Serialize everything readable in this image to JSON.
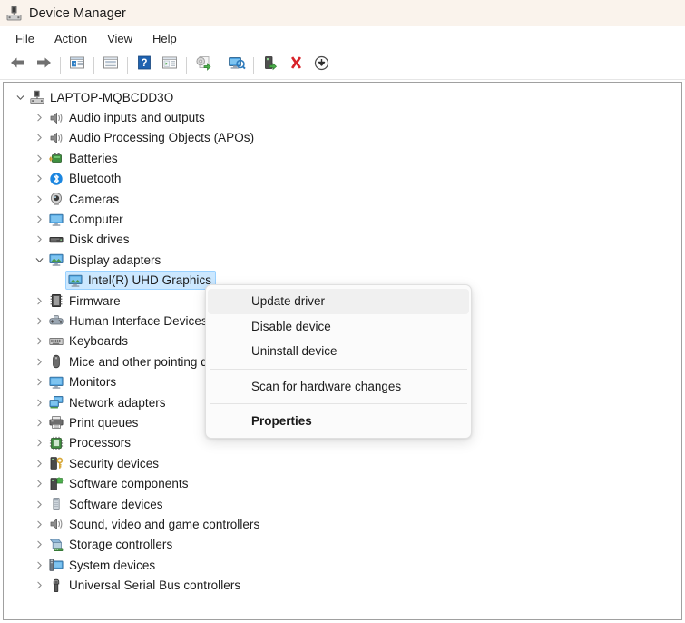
{
  "window": {
    "title": "Device Manager",
    "icon": "device-manager-icon"
  },
  "menubar": {
    "items": [
      {
        "label": "File",
        "name": "menu-file"
      },
      {
        "label": "Action",
        "name": "menu-action"
      },
      {
        "label": "View",
        "name": "menu-view"
      },
      {
        "label": "Help",
        "name": "menu-help"
      }
    ]
  },
  "toolbar": {
    "buttons": [
      {
        "icon": "back-arrow-icon",
        "name": "toolbar-back"
      },
      {
        "icon": "forward-arrow-icon",
        "name": "toolbar-forward"
      },
      {
        "icon": "separator",
        "name": "toolbar-separator-1"
      },
      {
        "icon": "show-hide-console-tree-icon",
        "name": "toolbar-console-tree"
      },
      {
        "icon": "separator",
        "name": "toolbar-separator-2"
      },
      {
        "icon": "properties-icon",
        "name": "toolbar-properties"
      },
      {
        "icon": "separator",
        "name": "toolbar-separator-3"
      },
      {
        "icon": "help-question-icon",
        "name": "toolbar-help"
      },
      {
        "icon": "show-hide-action-pane-icon",
        "name": "toolbar-action-pane"
      },
      {
        "icon": "separator",
        "name": "toolbar-separator-4"
      },
      {
        "icon": "update-driver-icon",
        "name": "toolbar-update-driver"
      },
      {
        "icon": "separator",
        "name": "toolbar-separator-5"
      },
      {
        "icon": "scan-hardware-changes-icon",
        "name": "toolbar-scan-hardware"
      },
      {
        "icon": "separator",
        "name": "toolbar-separator-6"
      },
      {
        "icon": "enable-device-icon",
        "name": "toolbar-enable-device"
      },
      {
        "icon": "uninstall-device-icon",
        "name": "toolbar-uninstall-device"
      },
      {
        "icon": "disable-device-icon",
        "name": "toolbar-disable-device"
      }
    ]
  },
  "tree": {
    "nodes": [
      {
        "label": "LAPTOP-MQBCDD3O",
        "depth": 0,
        "state": "expanded",
        "icon": "computer-root-icon",
        "selected": false
      },
      {
        "label": "Audio inputs and outputs",
        "depth": 1,
        "state": "collapsed",
        "icon": "speaker-icon",
        "selected": false
      },
      {
        "label": "Audio Processing Objects (APOs)",
        "depth": 1,
        "state": "collapsed",
        "icon": "speaker-icon",
        "selected": false
      },
      {
        "label": "Batteries",
        "depth": 1,
        "state": "collapsed",
        "icon": "battery-icon",
        "selected": false
      },
      {
        "label": "Bluetooth",
        "depth": 1,
        "state": "collapsed",
        "icon": "bluetooth-icon",
        "selected": false
      },
      {
        "label": "Cameras",
        "depth": 1,
        "state": "collapsed",
        "icon": "camera-icon",
        "selected": false
      },
      {
        "label": "Computer",
        "depth": 1,
        "state": "collapsed",
        "icon": "monitor-icon",
        "selected": false
      },
      {
        "label": "Disk drives",
        "depth": 1,
        "state": "collapsed",
        "icon": "disk-drive-icon",
        "selected": false
      },
      {
        "label": "Display adapters",
        "depth": 1,
        "state": "expanded",
        "icon": "display-adapter-icon",
        "selected": false
      },
      {
        "label": "Intel(R) UHD Graphics",
        "depth": 2,
        "state": "leaf",
        "icon": "display-adapter-icon",
        "selected": true
      },
      {
        "label": "Firmware",
        "depth": 1,
        "state": "collapsed",
        "icon": "firmware-icon",
        "selected": false
      },
      {
        "label": "Human Interface Devices",
        "depth": 1,
        "state": "collapsed",
        "icon": "hid-icon",
        "selected": false
      },
      {
        "label": "Keyboards",
        "depth": 1,
        "state": "collapsed",
        "icon": "keyboard-icon",
        "selected": false
      },
      {
        "label": "Mice and other pointing devices",
        "depth": 1,
        "state": "collapsed",
        "icon": "mouse-icon",
        "selected": false
      },
      {
        "label": "Monitors",
        "depth": 1,
        "state": "collapsed",
        "icon": "monitor-icon",
        "selected": false
      },
      {
        "label": "Network adapters",
        "depth": 1,
        "state": "collapsed",
        "icon": "network-adapter-icon",
        "selected": false
      },
      {
        "label": "Print queues",
        "depth": 1,
        "state": "collapsed",
        "icon": "printer-icon",
        "selected": false
      },
      {
        "label": "Processors",
        "depth": 1,
        "state": "collapsed",
        "icon": "processor-icon",
        "selected": false
      },
      {
        "label": "Security devices",
        "depth": 1,
        "state": "collapsed",
        "icon": "security-device-icon",
        "selected": false
      },
      {
        "label": "Software components",
        "depth": 1,
        "state": "collapsed",
        "icon": "software-component-icon",
        "selected": false
      },
      {
        "label": "Software devices",
        "depth": 1,
        "state": "collapsed",
        "icon": "software-device-icon",
        "selected": false
      },
      {
        "label": "Sound, video and game controllers",
        "depth": 1,
        "state": "collapsed",
        "icon": "speaker-icon",
        "selected": false
      },
      {
        "label": "Storage controllers",
        "depth": 1,
        "state": "collapsed",
        "icon": "storage-controller-icon",
        "selected": false
      },
      {
        "label": "System devices",
        "depth": 1,
        "state": "collapsed",
        "icon": "system-device-icon",
        "selected": false
      },
      {
        "label": "Universal Serial Bus controllers",
        "depth": 1,
        "state": "collapsed",
        "icon": "usb-icon",
        "selected": false
      }
    ]
  },
  "context_menu": {
    "items": [
      {
        "label": "Update driver",
        "type": "item",
        "hovered": true,
        "bold": false,
        "name": "ctx-update-driver"
      },
      {
        "label": "Disable device",
        "type": "item",
        "hovered": false,
        "bold": false,
        "name": "ctx-disable-device"
      },
      {
        "label": "Uninstall device",
        "type": "item",
        "hovered": false,
        "bold": false,
        "name": "ctx-uninstall-device"
      },
      {
        "type": "separator",
        "name": "ctx-separator-1"
      },
      {
        "label": "Scan for hardware changes",
        "type": "item",
        "hovered": false,
        "bold": false,
        "name": "ctx-scan-hardware-changes"
      },
      {
        "type": "separator",
        "name": "ctx-separator-2"
      },
      {
        "label": "Properties",
        "type": "item",
        "hovered": false,
        "bold": true,
        "name": "ctx-properties"
      }
    ]
  },
  "colors": {
    "titlebar_bg": "#faf3ec",
    "selection_bg": "#cce8ff",
    "selection_border": "#99d1ff",
    "menu_hover_bg": "#f0f0f0",
    "panel_border": "#a0a0a0",
    "accent_blue": "#0078d4",
    "accent_green": "#3aa03a",
    "accent_red": "#d8232a"
  }
}
